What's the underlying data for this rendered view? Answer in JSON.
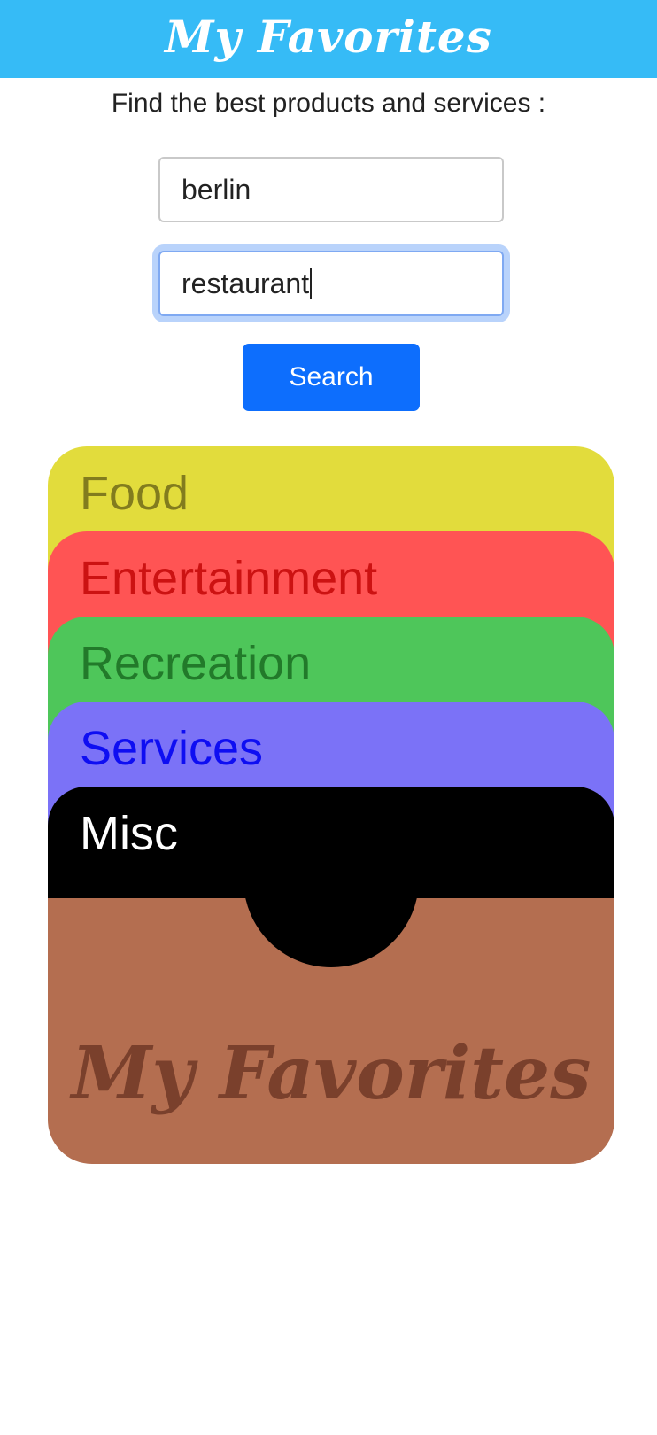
{
  "header": {
    "title": "My Favorites",
    "bg": "#36bbf6"
  },
  "search": {
    "tagline": "Find the best products and services :",
    "location_value": "berlin",
    "query_value": "restaurant",
    "button_label": "Search"
  },
  "wallet": {
    "cards": [
      {
        "label": "Food",
        "bg": "#e2dc3c",
        "fg": "#827c1e"
      },
      {
        "label": "Entertainment",
        "bg": "#ff5454",
        "fg": "#cc1212"
      },
      {
        "label": "Recreation",
        "bg": "#4ec65a",
        "fg": "#227a2a"
      },
      {
        "label": "Services",
        "bg": "#7b72f7",
        "fg": "#0e0ef2"
      },
      {
        "label": "Misc",
        "bg": "#000000",
        "fg": "#ffffff"
      }
    ],
    "pocket_title": "My Favorites",
    "pocket_bg": "#b46e50"
  }
}
